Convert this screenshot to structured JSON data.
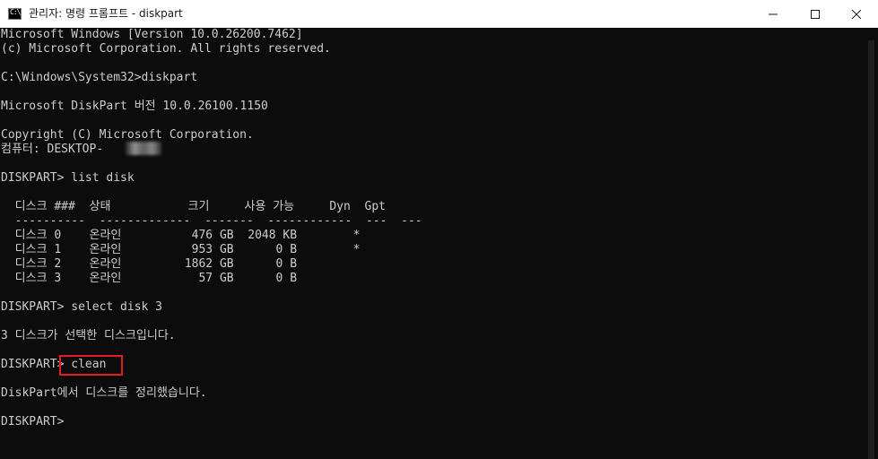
{
  "window": {
    "title": "관리자: 명령 프롬프트 - diskpart",
    "icon": "command-prompt-icon",
    "controls": {
      "minimize_icon": "minimize-icon",
      "maximize_icon": "maximize-icon",
      "close_icon": "close-icon"
    }
  },
  "console": {
    "lines": [
      "Microsoft Windows [Version 10.0.26200.7462]",
      "(c) Microsoft Corporation. All rights reserved.",
      "C:\\Windows\\System32>diskpart",
      "Microsoft DiskPart 버전 10.0.26100.1150",
      "Copyright (C) Microsoft Corporation.",
      "컴퓨터: DESKTOP-",
      "DISKPART> list disk",
      "  디스크 ###  상태           크기     사용 가능     Dyn  Gpt",
      "  ----------  -------------  -------  ------------  ---  ---",
      "  디스크 0    온라인          476 GB  2048 KB        *",
      "  디스크 1    온라인          953 GB      0 B        *",
      "  디스크 2    온라인         1862 GB      0 B",
      "  디스크 3    온라인           57 GB      0 B",
      "DISKPART> select disk 3",
      "3 디스크가 선택한 디스크입니다.",
      "DISKPART> clean",
      "DiskPart에서 디스크를 정리했습니다.",
      "DISKPART>"
    ]
  },
  "colors": {
    "console_background": "#0c0c0c",
    "console_text": "#cccccc",
    "highlight_border": "#e31d1d",
    "titlebar_background": "#ffffff"
  }
}
